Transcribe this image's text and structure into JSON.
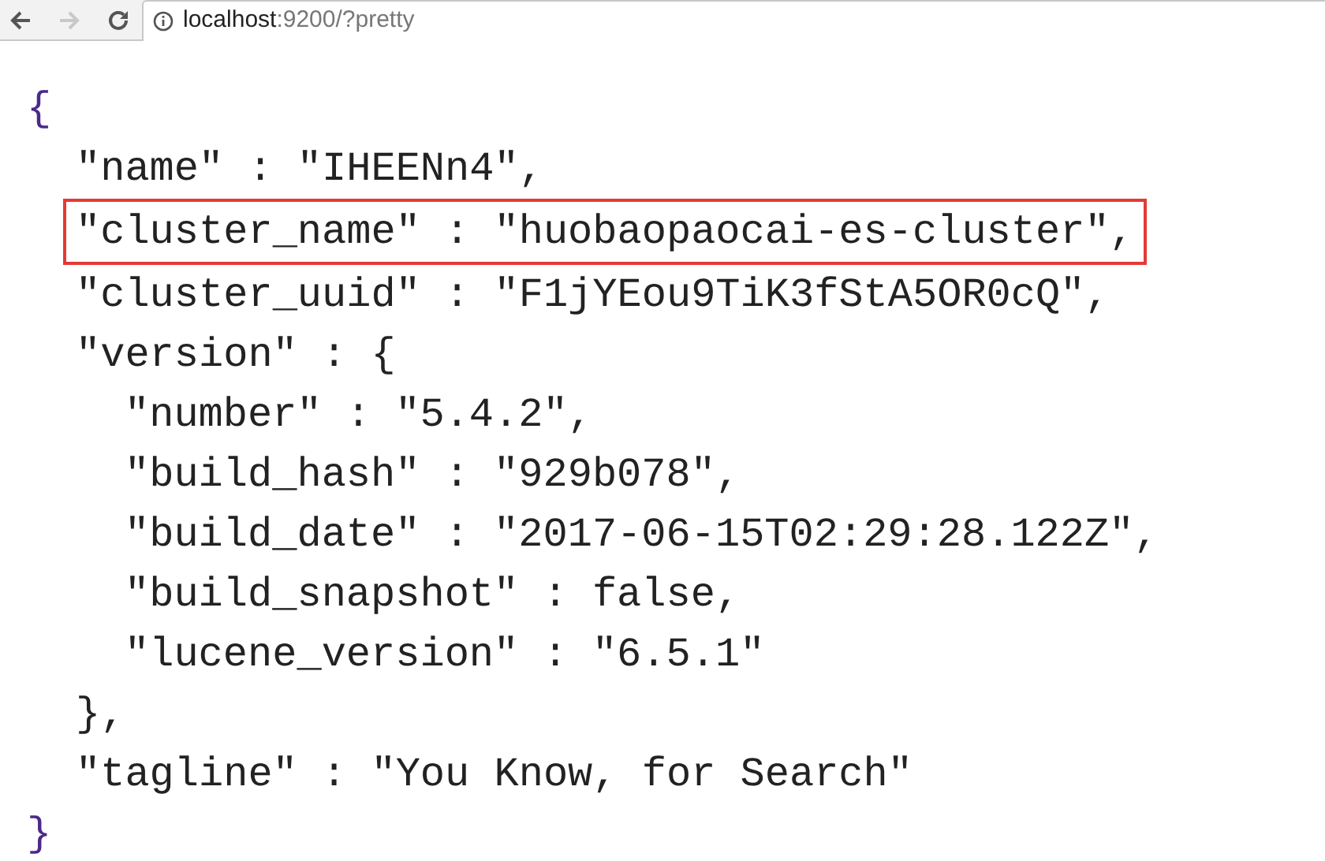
{
  "toolbar": {
    "back_enabled": true,
    "forward_enabled": false,
    "url": {
      "host": "localhost",
      "rest": ":9200/?pretty"
    }
  },
  "json_view": {
    "open": "{",
    "close": "}",
    "entries": [
      {
        "text": "\"name\" : \"IHEENn4\",",
        "highlighted": false
      },
      {
        "text": "\"cluster_name\" : \"huobaopaocai-es-cluster\",",
        "highlighted": true
      },
      {
        "text": "\"cluster_uuid\" : \"F1jYEou9TiK3fStA5OR0cQ\",",
        "highlighted": false
      },
      {
        "text": "\"version\" : {",
        "highlighted": false,
        "children": [
          {
            "text": "\"number\" : \"5.4.2\",",
            "highlighted": false
          },
          {
            "text": "\"build_hash\" : \"929b078\",",
            "highlighted": false
          },
          {
            "text": "\"build_date\" : \"2017-06-15T02:29:28.122Z\",",
            "highlighted": false
          },
          {
            "text": "\"build_snapshot\" : false,",
            "highlighted": false
          },
          {
            "text": "\"lucene_version\" : \"6.5.1\"",
            "highlighted": false
          }
        ]
      },
      {
        "text": "},",
        "highlighted": false
      },
      {
        "text": "\"tagline\" : \"You Know, for Search\"",
        "highlighted": false
      }
    ]
  }
}
